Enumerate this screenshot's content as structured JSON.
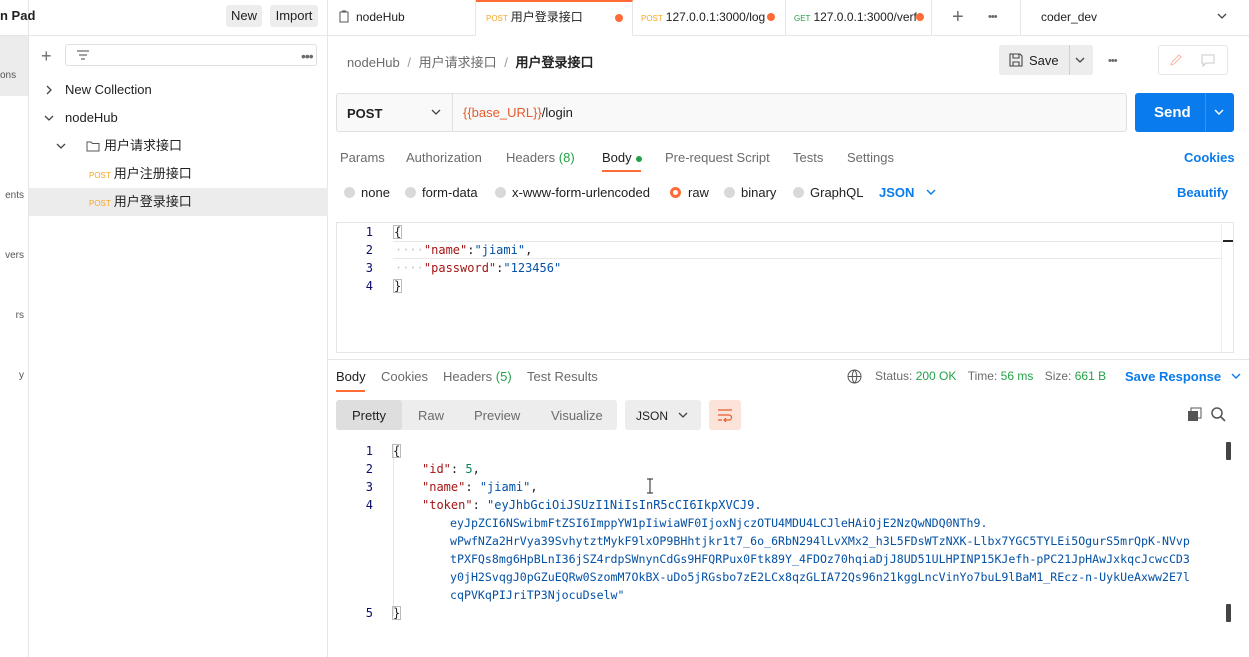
{
  "sidebar_rail": {
    "items": [
      "ons",
      "ents",
      "vers",
      "rs",
      "y"
    ]
  },
  "workspace": {
    "title": "n Pad",
    "new_label": "New",
    "import_label": "Import"
  },
  "tree": {
    "items": [
      {
        "label": "New Collection"
      },
      {
        "label": "nodeHub"
      },
      {
        "label": "用户请求接口"
      },
      {
        "method": "POST",
        "label": "用户注册接口"
      },
      {
        "method": "POST",
        "label": "用户登录接口"
      }
    ]
  },
  "tabs": [
    {
      "label": "nodeHub"
    },
    {
      "method": "POST",
      "label": "用户登录接口"
    },
    {
      "method": "POST",
      "label": "127.0.0.1:3000/log"
    },
    {
      "method": "GET",
      "label": "127.0.0.1:3000/verf"
    }
  ],
  "environment": {
    "label": "coder_dev"
  },
  "breadcrumb": {
    "parts": [
      "nodeHub",
      "用户请求接口",
      "用户登录接口"
    ],
    "sep": "/"
  },
  "toolbar": {
    "save_label": "Save"
  },
  "request": {
    "method": "POST",
    "url_var": "{{base_URL}}",
    "url_path": "/login",
    "send_label": "Send"
  },
  "request_tabs": {
    "items": [
      "Params",
      "Authorization",
      "Headers",
      "Body",
      "Pre-request Script",
      "Tests",
      "Settings"
    ],
    "headers_count": "(8)",
    "cookies_label": "Cookies"
  },
  "body_types": {
    "items": [
      "none",
      "form-data",
      "x-www-form-urlencoded",
      "raw",
      "binary",
      "GraphQL"
    ],
    "selected": "raw",
    "format": "JSON",
    "beautify_label": "Beautify"
  },
  "request_body": {
    "line_numbers": [
      "1",
      "2",
      "3",
      "4"
    ],
    "open": "{",
    "close": "}",
    "dots": "····",
    "fields": [
      {
        "key": "\"name\"",
        "colon": ":",
        "value": "\"jiami\"",
        "trail": ","
      },
      {
        "key": "\"password\"",
        "colon": ":",
        "value": "\"123456\"",
        "trail": ""
      }
    ]
  },
  "response_tabs": {
    "items": [
      "Body",
      "Cookies",
      "Headers",
      "Test Results"
    ],
    "headers_count": "(5)"
  },
  "response_status": {
    "status_label": "Status:",
    "status_value": "200 OK",
    "time_label": "Time:",
    "time_value": "56 ms",
    "size_label": "Size:",
    "size_value": "661 B",
    "save_response_label": "Save Response"
  },
  "response_view": {
    "modes": [
      "Pretty",
      "Raw",
      "Preview",
      "Visualize"
    ],
    "selected": "Pretty",
    "format": "JSON"
  },
  "response_body": {
    "line_numbers": [
      "1",
      "2",
      "3",
      "4",
      "",
      "",
      "",
      "",
      "",
      "5"
    ],
    "open": "{",
    "close": "}",
    "id_key": "\"id\"",
    "id_value": "5",
    "name_key": "\"name\"",
    "name_value": "\"jiami\"",
    "token_key": "\"token\"",
    "token_lines": [
      "\"eyJhbGciOiJSUzI1NiIsInR5cCI6IkpXVCJ9.",
      "eyJpZCI6NSwibmFtZSI6ImppYW1pIiwiaWF0IjoxNjczOTU4MDU4LCJleHAiOjE2NzQwNDQ0NTh9.",
      "wPwfNZa2HrVya39SvhytztMykF9lxOP9BHhtjkr1t7_6o_6RbN294lLvXMx2_h3L5FDsWTzNXK-Llbx7YGC5TYLEi5OgurS5mrQpK-NVvp",
      "tPXFQs8mg6HpBLnI36jSZ4rdpSWnynCdGs9HFQRPux0Ftk89Y_4FDOz70hqiaDjJ8UD51ULHPINP15KJefh-pPC21JpHAwJxkqcJcwcCD3",
      "y0jH2SvqgJ0pGZuEQRw0SzomM7OkBX-uDo5jRGsbo7zE2LCx8qzGLIA72Qs96n21kggLncVinYo7buL9lBaM1_REcz-n-UykUeAxww2E7l",
      "cqPVKqPIJriTP3NjocuDselw\""
    ]
  },
  "colors": {
    "accent": "#ff6c37",
    "send": "#097bed",
    "status_ok": "#24a148"
  }
}
